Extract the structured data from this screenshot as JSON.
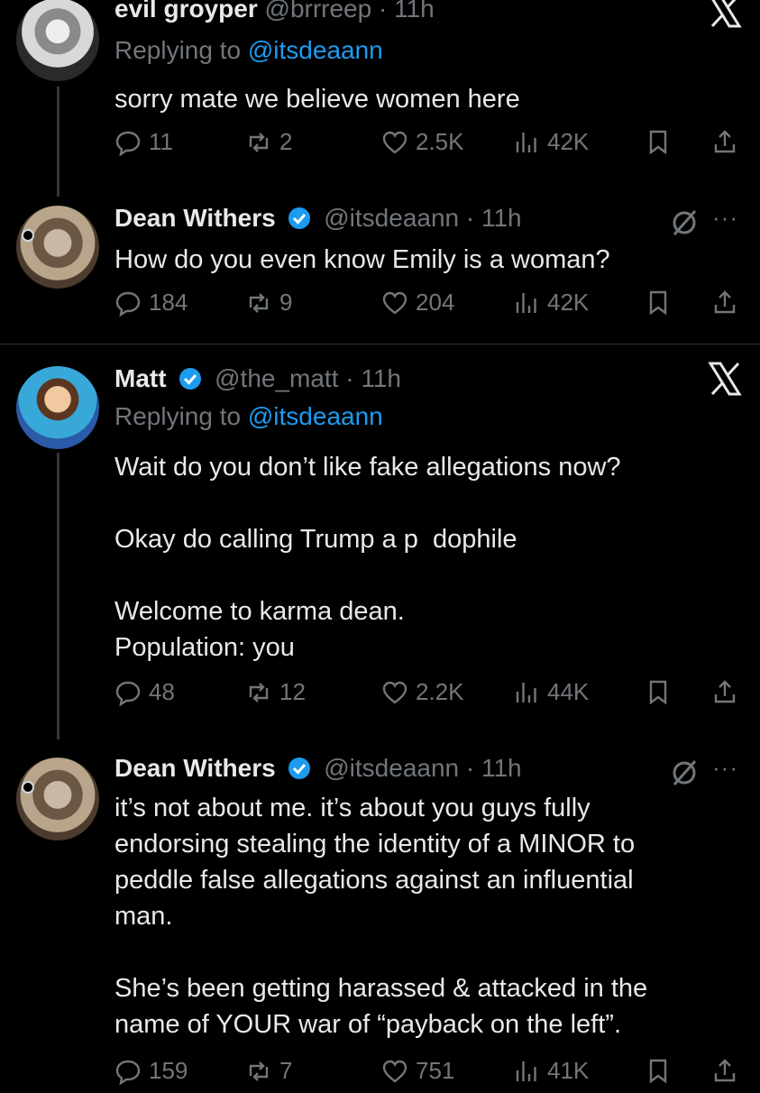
{
  "posts": [
    {
      "name": "evil groyper",
      "handle": "@brrreep",
      "time": "· 11h",
      "replying_prefix": "Replying to",
      "replying_to": "@itsdeaann",
      "lines": [
        "sorry mate we believe women here"
      ],
      "stats": {
        "replies": "11",
        "reposts": "2",
        "likes": "2.5K",
        "views": "42K"
      }
    },
    {
      "name": "Dean Withers",
      "handle": "@itsdeaann",
      "time": "· 11h",
      "lines": [
        "How do you even know Emily is a woman?"
      ],
      "stats": {
        "replies": "184",
        "reposts": "9",
        "likes": "204",
        "views": "42K"
      }
    },
    {
      "name": "Matt",
      "handle": "@the_matt",
      "time": "· 11h",
      "replying_prefix": "Replying to",
      "replying_to": "@itsdeaann",
      "lines": [
        "Wait do you don’t like fake allegations now?",
        "",
        "Okay do calling Trump a p  dophile",
        "",
        "Welcome to karma dean.",
        "Population: you"
      ],
      "stats": {
        "replies": "48",
        "reposts": "12",
        "likes": "2.2K",
        "views": "44K"
      }
    },
    {
      "name": "Dean Withers",
      "handle": "@itsdeaann",
      "time": "· 11h",
      "lines": [
        "it’s not about me. it’s about you guys fully",
        "endorsing stealing the identity of a MINOR to",
        "peddle false allegations against an influential",
        "man.",
        "",
        "She’s been getting harassed & attacked in the",
        "name of YOUR war of “payback on the left”."
      ],
      "stats": {
        "replies": "159",
        "reposts": "7",
        "likes": "751",
        "views": "41K"
      }
    }
  ],
  "more_label": "···",
  "colors": {
    "background": "#000000",
    "text": "#e7e9ea",
    "muted": "#71767b",
    "accent": "#1d9bf0",
    "verified": "#1d9bf0"
  }
}
